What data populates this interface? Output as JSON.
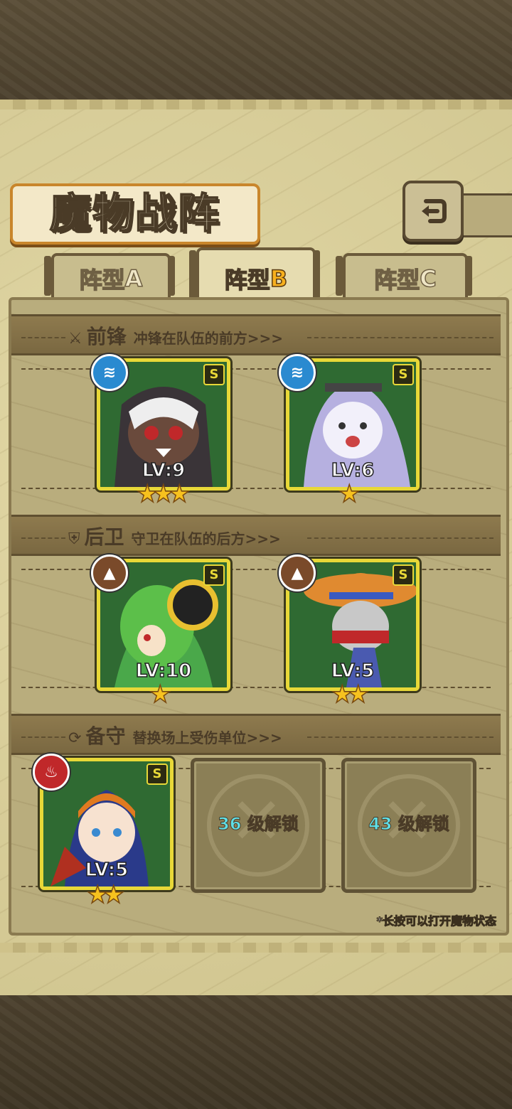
{
  "header": {
    "title": "魔物战阵",
    "back_icon": "back-arrow-icon"
  },
  "tabs": [
    {
      "label": "阵型",
      "letter": "A",
      "active": false
    },
    {
      "label": "阵型",
      "letter": "B",
      "active": true
    },
    {
      "label": "阵型",
      "letter": "C",
      "active": false
    }
  ],
  "sections": {
    "front": {
      "title": "前锋",
      "desc": "冲锋在队伍的前方>>>",
      "icon": "sword-icon"
    },
    "rear": {
      "title": "后卫",
      "desc": "守卫在队伍的后方>>>",
      "icon": "shield-icon"
    },
    "reserve": {
      "title": "备守",
      "desc": "替换场上受伤单位>>>",
      "icon": "swap-icon"
    }
  },
  "front_units": [
    {
      "level": "LV:9",
      "rank": "S",
      "stars": 3,
      "element": "water",
      "element_color": "#2a8ad0"
    },
    {
      "level": "LV:6",
      "rank": "S",
      "stars": 1,
      "element": "water",
      "element_color": "#2a8ad0"
    }
  ],
  "rear_units": [
    {
      "level": "LV:10",
      "rank": "S",
      "stars": 1,
      "element": "earth",
      "element_color": "#7a4a2a"
    },
    {
      "level": "LV:5",
      "rank": "S",
      "stars": 2,
      "element": "earth",
      "element_color": "#7a4a2a"
    }
  ],
  "reserve_units": [
    {
      "level": "LV:5",
      "rank": "S",
      "stars": 2,
      "element": "fire",
      "element_color": "#c0282a"
    }
  ],
  "locked_slots": [
    {
      "level": "36",
      "text": "级解锁"
    },
    {
      "level": "43",
      "text": "级解锁"
    }
  ],
  "hint": "*长按可以打开魔物状态"
}
